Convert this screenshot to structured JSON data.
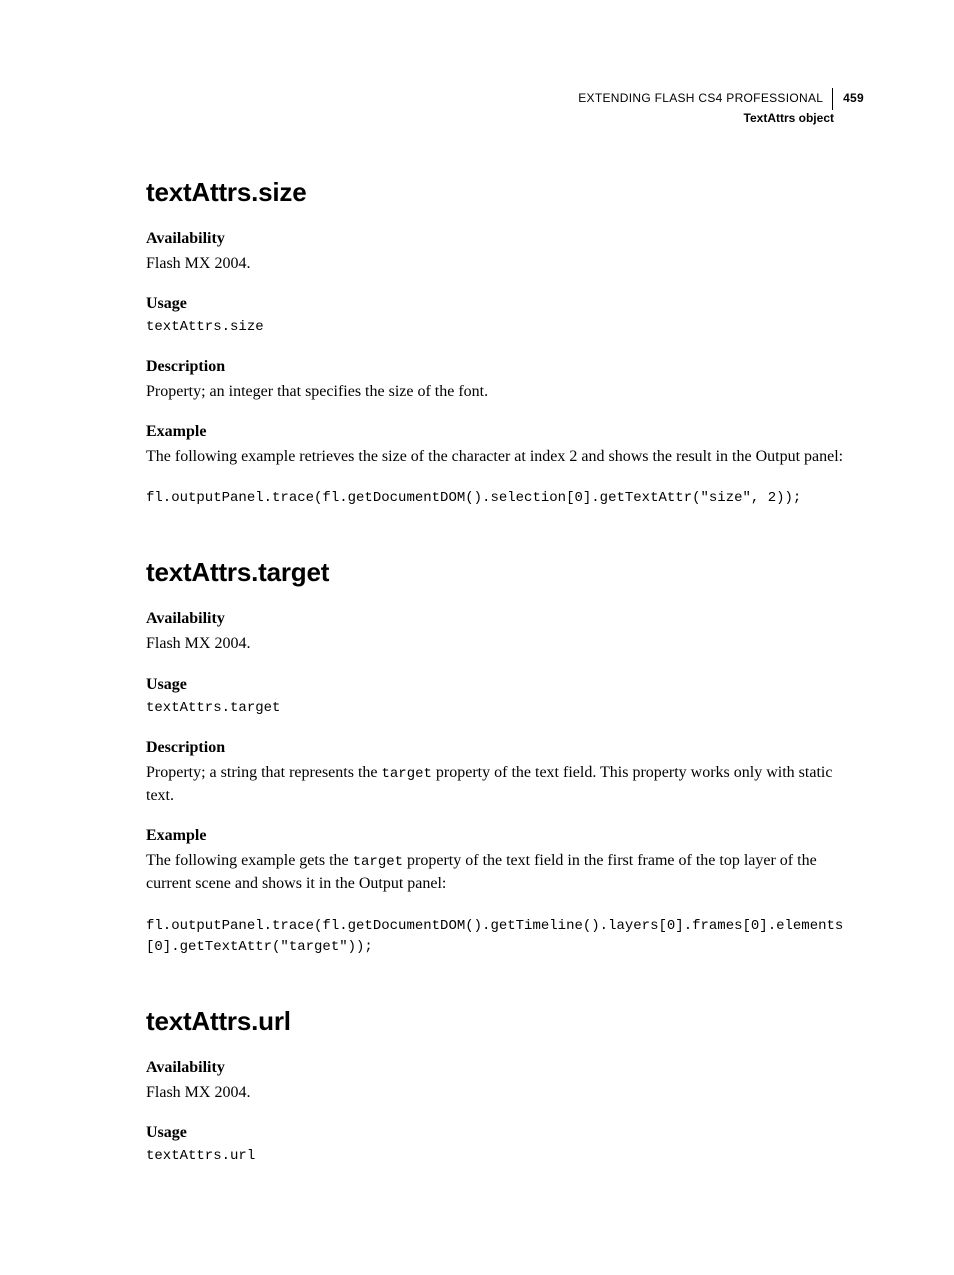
{
  "header": {
    "title": "EXTENDING FLASH CS4 PROFESSIONAL",
    "page_number": "459",
    "subtitle": "TextAttrs object"
  },
  "sections": [
    {
      "heading": "textAttrs.size",
      "availability_label": "Availability",
      "availability_text": "Flash MX 2004.",
      "usage_label": "Usage",
      "usage_code": "textAttrs.size",
      "description_label": "Description",
      "description_text": "Property; an integer that specifies the size of the font.",
      "example_label": "Example",
      "example_intro": "The following example retrieves the size of the character at index 2 and shows the result in the Output panel:",
      "example_code": "fl.outputPanel.trace(fl.getDocumentDOM().selection[0].getTextAttr(\"size\", 2));"
    },
    {
      "heading": "textAttrs.target",
      "availability_label": "Availability",
      "availability_text": "Flash MX 2004.",
      "usage_label": "Usage",
      "usage_code": "textAttrs.target",
      "description_label": "Description",
      "description_pre": "Property; a string that represents the ",
      "description_code": "target",
      "description_post": " property of the text field. This property works only with static text.",
      "example_label": "Example",
      "example_intro_pre": "The following example gets the ",
      "example_intro_code": "target",
      "example_intro_post": " property of the text field in the first frame of the top layer of the current scene and shows it in the Output panel:",
      "example_code": "fl.outputPanel.trace(fl.getDocumentDOM().getTimeline().layers[0].frames[0].elements[0].getTextAttr(\"target\"));"
    },
    {
      "heading": "textAttrs.url",
      "availability_label": "Availability",
      "availability_text": "Flash MX 2004.",
      "usage_label": "Usage",
      "usage_code": "textAttrs.url"
    }
  ]
}
